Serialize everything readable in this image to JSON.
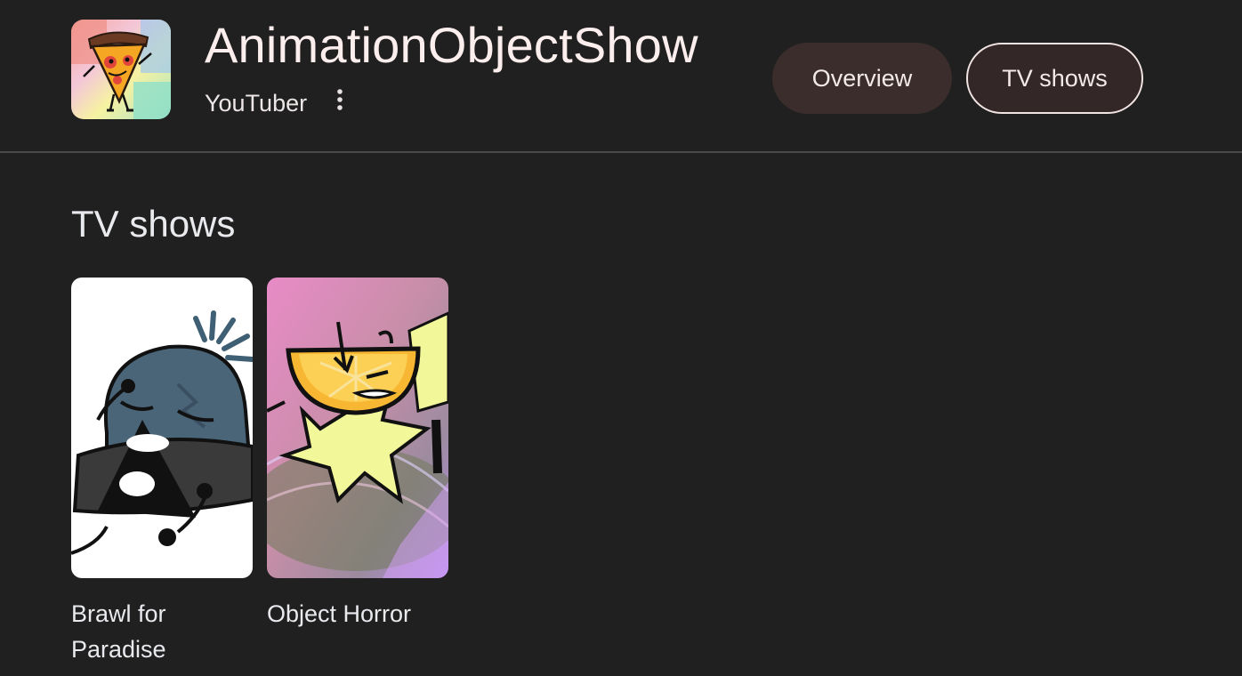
{
  "header": {
    "title": "AnimationObjectShow",
    "subtitle": "YouTuber",
    "avatar_icon": "pizza-character-avatar",
    "more_icon": "more-vert-icon",
    "tabs": [
      {
        "label": "Overview",
        "selected": false
      },
      {
        "label": "TV shows",
        "selected": true
      }
    ]
  },
  "section": {
    "title": "TV shows",
    "items": [
      {
        "label": "Brawl for Paradise",
        "thumbnail": "beanie-character-thumbnail"
      },
      {
        "label": "Object Horror",
        "thumbnail": "lemon-character-thumbnail"
      }
    ]
  },
  "colors": {
    "background": "#202020",
    "title_text": "#fdeeee",
    "chip_fill": "#3a2d2c",
    "selected_chip_border": "#f3e4e4",
    "divider": "#4a4a4a"
  }
}
